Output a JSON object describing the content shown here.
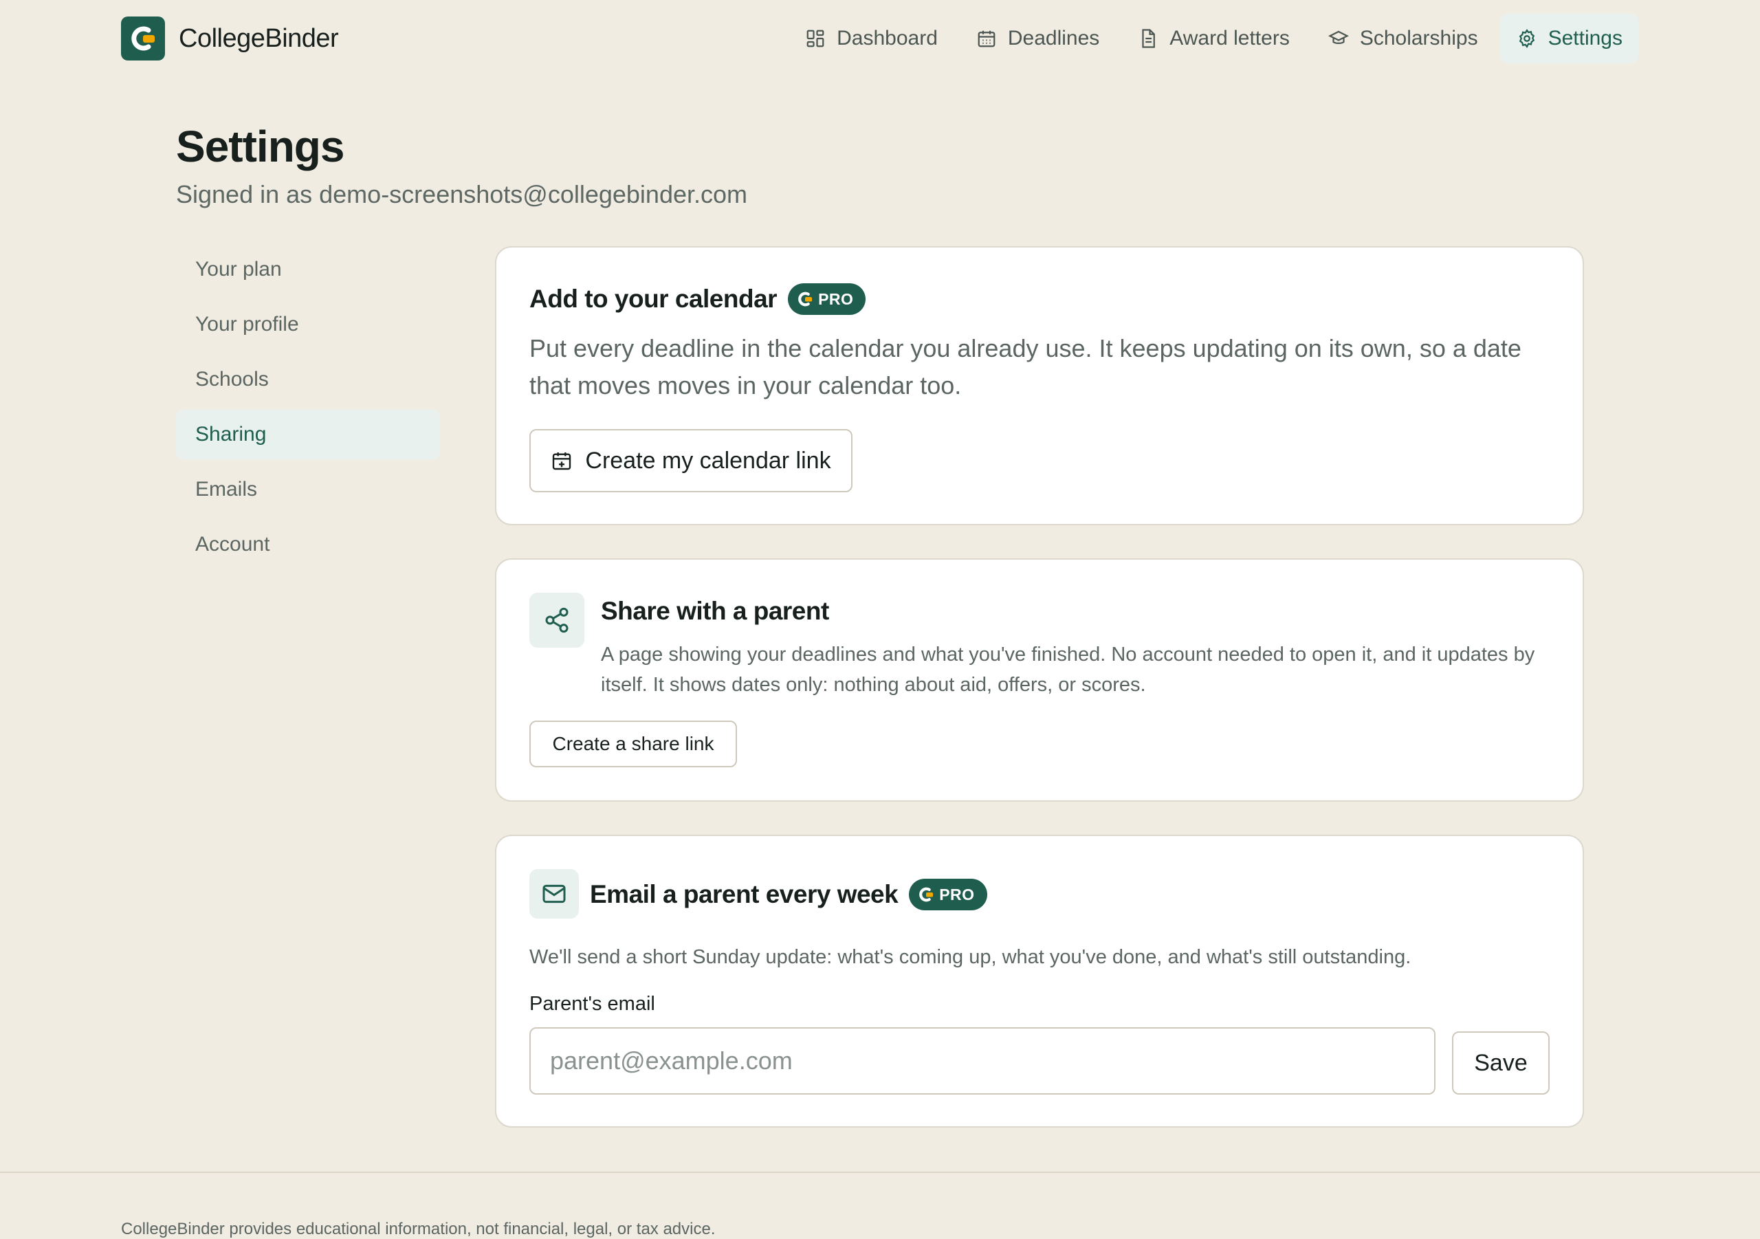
{
  "header": {
    "brand": "CollegeBinder",
    "nav": [
      {
        "label": "Dashboard",
        "icon": "dashboard-icon"
      },
      {
        "label": "Deadlines",
        "icon": "calendar-icon"
      },
      {
        "label": "Award letters",
        "icon": "document-icon"
      },
      {
        "label": "Scholarships",
        "icon": "graduation-cap-icon"
      },
      {
        "label": "Settings",
        "icon": "gear-icon",
        "active": true
      }
    ]
  },
  "page": {
    "title": "Settings",
    "signed_in": "Signed in as demo-screenshots@collegebinder.com"
  },
  "sidebar": {
    "items": [
      {
        "label": "Your plan"
      },
      {
        "label": "Your profile"
      },
      {
        "label": "Schools"
      },
      {
        "label": "Sharing",
        "active": true
      },
      {
        "label": "Emails"
      },
      {
        "label": "Account"
      }
    ]
  },
  "calendar_card": {
    "title": "Add to your calendar",
    "badge": "PRO",
    "description": "Put every deadline in the calendar you already use. It keeps updating on its own, so a date that moves moves in your calendar too.",
    "button": "Create my calendar link"
  },
  "share_card": {
    "title": "Share with a parent",
    "description": "A page showing your deadlines and what you've finished. No account needed to open it, and it updates by itself. It shows dates only: nothing about aid, offers, or scores.",
    "button": "Create a share link"
  },
  "email_card": {
    "title": "Email a parent every week",
    "badge": "PRO",
    "description": "We'll send a short Sunday update: what's coming up, what you've done, and what's still outstanding.",
    "field_label": "Parent's email",
    "field_value": "",
    "field_placeholder": "parent@example.com",
    "button": "Save"
  },
  "footer": {
    "text": "CollegeBinder provides educational information, not financial, legal, or tax advice."
  },
  "colors": {
    "background": "#f1ece2",
    "brand": "#1f5e4e",
    "active_bg": "#e8f1ee",
    "logo_accent": "#f0a800"
  }
}
